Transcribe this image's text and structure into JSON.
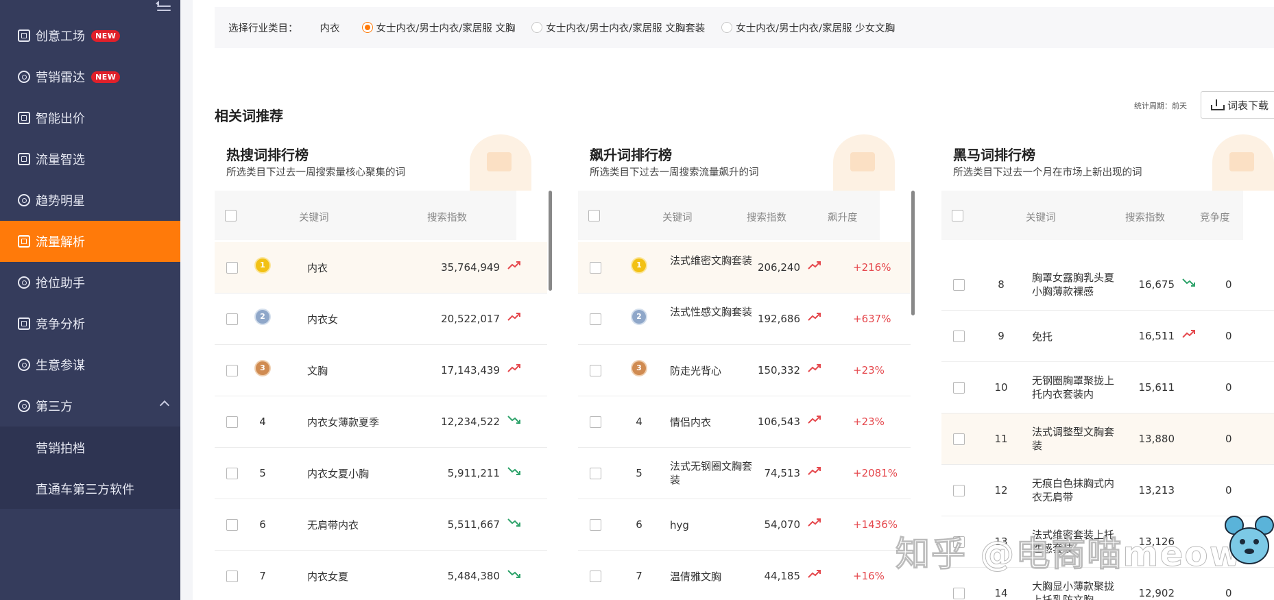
{
  "sidebar": {
    "items": [
      {
        "label": "创意工场",
        "badge": "NEW"
      },
      {
        "label": "营销雷达",
        "badge": "NEW"
      },
      {
        "label": "智能出价"
      },
      {
        "label": "流量智选"
      },
      {
        "label": "趋势明星"
      },
      {
        "label": "流量解析"
      },
      {
        "label": "抢位助手"
      },
      {
        "label": "竞争分析"
      },
      {
        "label": "生意参谋"
      },
      {
        "label": "第三方"
      }
    ],
    "subitems": [
      "营销拍档",
      "直通车第三方软件"
    ],
    "active": "流量解析"
  },
  "filter": {
    "label": "选择行业类目：",
    "category": "内衣",
    "options": [
      "女士内衣/男士内衣/家居服 文胸",
      "女士内衣/男士内衣/家居服 文胸套装",
      "女士内衣/男士内衣/家居服 少女文胸"
    ],
    "selected": 0
  },
  "section": {
    "title": "相关词推荐",
    "period": "统计周期：前天",
    "download": "词表下载"
  },
  "panels": {
    "hot": {
      "title": "热搜词排行榜",
      "subtitle": "所选类目下过去一周搜索量核心聚集的词",
      "headers": [
        "关键词",
        "搜索指数"
      ],
      "rows": [
        {
          "rank": "1",
          "kw": "内衣",
          "idx": "35,764,949",
          "trend": "up"
        },
        {
          "rank": "2",
          "kw": "内衣女",
          "idx": "20,522,017",
          "trend": "up"
        },
        {
          "rank": "3",
          "kw": "文胸",
          "idx": "17,143,439",
          "trend": "up"
        },
        {
          "rank": "4",
          "kw": "内衣女薄款夏季",
          "idx": "12,234,522",
          "trend": "down"
        },
        {
          "rank": "5",
          "kw": "内衣女夏小胸",
          "idx": "5,911,211",
          "trend": "down"
        },
        {
          "rank": "6",
          "kw": "无肩带内衣",
          "idx": "5,511,667",
          "trend": "down"
        },
        {
          "rank": "7",
          "kw": "内衣女夏",
          "idx": "5,484,380",
          "trend": "down"
        }
      ]
    },
    "rising": {
      "title": "飙升词排行榜",
      "subtitle": "所选类目下过去一周搜索流量飙升的词",
      "headers": [
        "关键词",
        "搜索指数",
        "飙升度"
      ],
      "rows": [
        {
          "rank": "1",
          "kw": "法式维密文胸套装",
          "idx": "206,240",
          "trend": "up",
          "rise": "+216%"
        },
        {
          "rank": "2",
          "kw": "法式性感文胸套装",
          "idx": "192,686",
          "trend": "up",
          "rise": "+637%"
        },
        {
          "rank": "3",
          "kw": "防走光背心",
          "idx": "150,332",
          "trend": "up",
          "rise": "+23%"
        },
        {
          "rank": "4",
          "kw": "情侣内衣",
          "idx": "106,543",
          "trend": "up",
          "rise": "+23%"
        },
        {
          "rank": "5",
          "kw": "法式无钢圈文胸套装",
          "idx": "74,513",
          "trend": "up",
          "rise": "+2081%"
        },
        {
          "rank": "6",
          "kw": "hyg",
          "idx": "54,070",
          "trend": "up",
          "rise": "+1436%"
        },
        {
          "rank": "7",
          "kw": "温倩雅文胸",
          "idx": "44,185",
          "trend": "up",
          "rise": "+16%"
        }
      ]
    },
    "dark": {
      "title": "黑马词排行榜",
      "subtitle": "所选类目下过去一个月在市场上新出现的词",
      "headers": [
        "关键词",
        "搜索指数",
        "竞争度"
      ],
      "rows": [
        {
          "rank": "8",
          "kw": "胸罩女露胸乳头夏小胸薄款裸感",
          "idx": "16,675",
          "trend": "down",
          "comp": "0"
        },
        {
          "rank": "9",
          "kw": "免托",
          "idx": "16,511",
          "trend": "up",
          "comp": "0"
        },
        {
          "rank": "10",
          "kw": "无钢圈胸罩聚拢上托内衣套装内",
          "idx": "15,611",
          "trend": "none",
          "comp": "0"
        },
        {
          "rank": "11",
          "kw": "法式调整型文胸套装",
          "idx": "13,880",
          "trend": "none",
          "comp": "0"
        },
        {
          "rank": "12",
          "kw": "无痕白色抹胸式内衣无肩带",
          "idx": "13,213",
          "trend": "none",
          "comp": "0"
        },
        {
          "rank": "13",
          "kw": "法式维密套装上托性感套装",
          "idx": "13,126",
          "trend": "none",
          "comp": ""
        },
        {
          "rank": "14",
          "kw": "大胸显小薄款聚拢上托乳防文胸",
          "idx": "12,902",
          "trend": "none",
          "comp": "0"
        }
      ]
    }
  },
  "watermark": "知乎 @电商喵meow",
  "colors": {
    "accent": "#ff7a0a",
    "sidebar": "#353c5c",
    "up": "#e5484d",
    "down": "#2fa36b"
  }
}
